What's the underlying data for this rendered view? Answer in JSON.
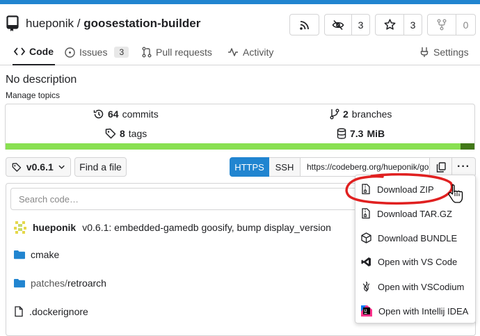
{
  "colors": {
    "accent": "#2185d0",
    "annotation": "#e02020",
    "lang_primary": "#89e051",
    "lang_secondary": "#427819",
    "folder": "#2185d0"
  },
  "repo": {
    "owner": "hueponik",
    "separator": "/",
    "name": "goosestation-builder"
  },
  "header_buttons": {
    "rss": {
      "icon": "rss-icon"
    },
    "watch": {
      "icon": "eye-slash-icon",
      "count": "3"
    },
    "star": {
      "icon": "star-icon",
      "count": "3"
    },
    "fork": {
      "icon": "fork-icon",
      "count": "0"
    }
  },
  "tabs": [
    {
      "label": "Code",
      "icon": "code-icon",
      "active": true
    },
    {
      "label": "Issues",
      "icon": "issue-icon",
      "badge": "3"
    },
    {
      "label": "Pull requests",
      "icon": "pull-request-icon"
    },
    {
      "label": "Activity",
      "icon": "activity-icon"
    },
    {
      "label": "Settings",
      "icon": "settings-icon"
    }
  ],
  "description": "No description",
  "manage_topics": "Manage topics",
  "stats": {
    "commits": {
      "count": "64",
      "label": "commits"
    },
    "branches": {
      "count": "2",
      "label": "branches"
    },
    "tags": {
      "count": "8",
      "label": "tags"
    },
    "size": {
      "count": "7.3",
      "label": "MiB"
    }
  },
  "toolbar": {
    "branch": "v0.6.1",
    "find_file": "Find a file",
    "https": "HTTPS",
    "ssh": "SSH",
    "clone_url": "https://codeberg.org/hueponik/go",
    "more": "···"
  },
  "search_placeholder": "Search code…",
  "last_commit": {
    "author": "hueponik",
    "message": "v0.6.1: embedded-gamedb goosify, bump display_version"
  },
  "files": [
    {
      "name": "cmake",
      "type": "folder"
    },
    {
      "prefix": "patches/",
      "name": "retroarch",
      "type": "folder"
    },
    {
      "name": ".dockerignore",
      "type": "file"
    }
  ],
  "download_menu": [
    {
      "label": "Download ZIP",
      "icon": "zip-file-icon"
    },
    {
      "label": "Download TAR.GZ",
      "icon": "zip-file-icon"
    },
    {
      "label": "Download BUNDLE",
      "icon": "package-icon"
    },
    {
      "label": "Open with VS Code",
      "icon": "vscode-icon"
    },
    {
      "label": "Open with VSCodium",
      "icon": "vscodium-icon"
    },
    {
      "label": "Open with Intellij IDEA",
      "icon": "intellij-icon"
    }
  ]
}
